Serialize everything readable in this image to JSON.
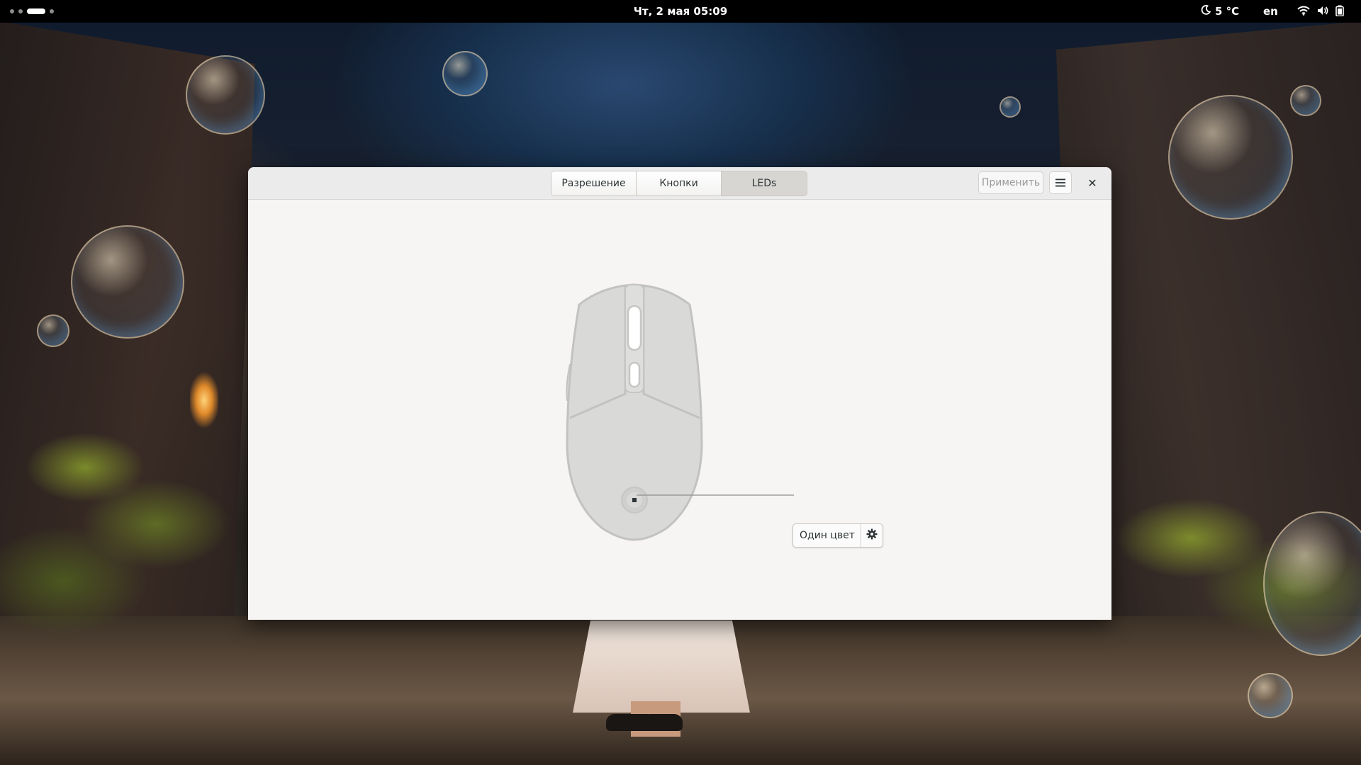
{
  "topbar": {
    "clock": "Чт, 2 мая  05:09",
    "weather_temp": "5 °C",
    "weather_icon": "moon-icon",
    "language": "en",
    "tray_icons": [
      "wifi-icon",
      "volume-icon",
      "battery-icon"
    ]
  },
  "window": {
    "tabs": [
      {
        "label": "Разрешение",
        "active": false
      },
      {
        "label": "Кнопки",
        "active": false
      },
      {
        "label": "LEDs",
        "active": true
      }
    ],
    "apply_label": "Применить",
    "menu_icon": "hamburger-menu-icon",
    "close_label": "✕"
  },
  "led": {
    "mode_label": "Один цвет",
    "settings_icon": "gear-icon"
  },
  "colors": {
    "window_bg": "#f6f5f4",
    "headerbar_bg": "#ebebeb",
    "active_tab_bg": "#d8d6d3",
    "mouse_fill": "#d9d9d7",
    "mouse_stroke": "#c2c2c0"
  }
}
